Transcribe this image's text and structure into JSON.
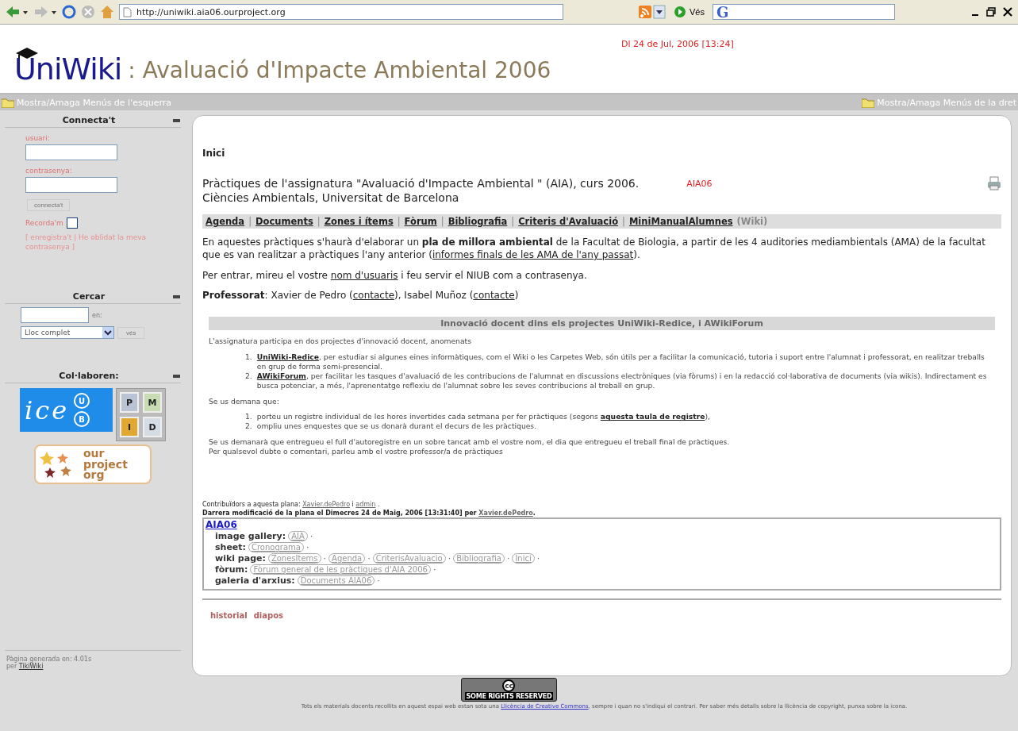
{
  "browser": {
    "url": "http://uniwiki.aia06.ourproject.org",
    "go_label": "Vés",
    "search_logo": "G"
  },
  "header": {
    "logo": "UniWiki",
    "site_title": ": Avaluació d'Impacte Ambiental 2006",
    "date": "Dl 24 de Jul, 2006 [13:24]"
  },
  "toggle_bar": {
    "left": "Mostra/Amaga Menús de l'esquerra",
    "right": "Mostra/Amaga Menús de la dret"
  },
  "sidebar": {
    "login": {
      "title": "Connecta't",
      "user_label": "usuari:",
      "password_label": "contrasenya:",
      "button": "connecta't",
      "remember_label": "Recorda'm",
      "remember_checked": false,
      "links": "[ enregistra't | He oblidat la meva contrasenya ]"
    },
    "search": {
      "title": "Cercar",
      "in_label": "en:",
      "scope": "Lloc complet",
      "button": "vés"
    },
    "partners": {
      "title": "Col·laboren:",
      "ice": {
        "word": "ice",
        "marks": [
          "U",
          "B"
        ]
      },
      "tiles": [
        {
          "letter": "P",
          "color": "#b8c4d4"
        },
        {
          "letter": "M",
          "color": "#c8dcb4"
        },
        {
          "letter": "I",
          "color": "#e0a830"
        },
        {
          "letter": "D",
          "color": "#d4dce4"
        }
      ],
      "ourproject": [
        "our",
        "project",
        "org"
      ]
    },
    "generated": "Pàgina generada en: 4.01s",
    "by": "per",
    "engine": "TikiWiki"
  },
  "main": {
    "page_name": "Inici",
    "title_lines": [
      "Pràctiques de l'assignatura \"Avaluació d'Impacte Ambiental \" (AIA), curs 2006.",
      "Ciències Ambientals, Universitat de Barcelona"
    ],
    "tag": "AIA06",
    "nav": {
      "separator": "|",
      "links": [
        "Agenda",
        "Documents",
        "Zones i ítems",
        "Fòrum",
        "Bibliografia",
        "Criteris d'Avaluació",
        "MiniManualAlumnes"
      ],
      "suffix": "(Wiki)"
    },
    "paragraphs": [
      [
        {
          "kind": "text",
          "text": "En aquestes pràctiques s'haurà d'elaborar un "
        },
        {
          "kind": "bold",
          "text": "pla de millora ambiental"
        },
        {
          "kind": "text",
          "text": " de la Facultat de Biologia, a partir de les 4 auditories mediambientals (AMA) de la facultat que es van realitzar a pràctiques l'any anterior ("
        },
        {
          "kind": "link",
          "text": "informes finals de les AMA de l'any passat"
        },
        {
          "kind": "text",
          "text": ")."
        }
      ],
      [
        {
          "kind": "text",
          "text": "Per entrar, mireu el vostre "
        },
        {
          "kind": "link",
          "text": "nom d'usuaris"
        },
        {
          "kind": "text",
          "text": " i feu servir el NIUB com a contrasenya."
        }
      ],
      [
        {
          "kind": "bold",
          "text": "Professorat"
        },
        {
          "kind": "text",
          "text": ": Xavier de Pedro ("
        },
        {
          "kind": "link",
          "text": "contacte"
        },
        {
          "kind": "text",
          "text": "), Isabel Muñoz ("
        },
        {
          "kind": "link",
          "text": "contacte"
        },
        {
          "kind": "text",
          "text": ")"
        }
      ]
    ],
    "box": {
      "heading": "Innovació docent dins els projectes UniWiki-Redice, i AWikiForum",
      "intro": "L'assignatura participa en dos projectes d'innovació docent, anomenats",
      "list1": [
        {
          "number": "1.",
          "segments": [
            {
              "kind": "bold-link",
              "text": "UniWiki-Redice"
            },
            {
              "kind": "text",
              "text": ", per estudiar si algunes eines informàtiques, com el Wiki o les Carpetes Web, són útils per a facilitar la comunicació, tutoria i suport entre l'alumnat i professorat, en realitzar treballs en grup de forma semi-presencial."
            }
          ]
        },
        {
          "number": "2.",
          "segments": [
            {
              "kind": "bold-link",
              "text": "AWikiForum"
            },
            {
              "kind": "text",
              "text": ", per facilitar les tasques d'avaluació de les contribucions de l'alumnat en discussions electròniques (via fòrums) i en la redacció col·laborativa de documents (via wikis). Indirectament es busca potenciar, a més, l'aprenentatge reflexiu de l'alumnat sobre les seves contribucions al treball en grup."
            }
          ]
        }
      ],
      "ask": "Se us demana que:",
      "list2": [
        {
          "number": "1.",
          "segments": [
            {
              "kind": "text",
              "text": "porteu un registre individual de les hores invertides cada setmana per fer pràctiques (segons "
            },
            {
              "kind": "bold-link",
              "text": "aquesta taula de registre"
            },
            {
              "kind": "text",
              "text": "),"
            }
          ]
        },
        {
          "number": "2.",
          "segments": [
            {
              "kind": "text",
              "text": "ompliu unes enquestes que se us donarà durant el decurs de les pràctiques."
            }
          ]
        }
      ],
      "closing": [
        "Se us demanarà que entregueu el full d'autoregistre en un sobre tancat amb el vostre nom, el dia que entregueu el treball final de pràctiques.",
        "Per qualsevol dubte o comentari, parleu amb el vostre professor/a de pràctiques"
      ]
    },
    "contributors": [
      {
        "kind": "text",
        "text": "Contribuïdors a aquesta plana: "
      },
      {
        "kind": "link",
        "text": "Xavier.dePedro"
      },
      {
        "kind": "text",
        "text": " i "
      },
      {
        "kind": "link",
        "text": "admin"
      },
      {
        "kind": "text",
        "text": " ."
      }
    ],
    "modified": [
      {
        "kind": "text",
        "text": "Darrera modificació de la plana el Dimecres 24 de Maig, 2006 [13:31:40] per "
      },
      {
        "kind": "link",
        "text": "Xavier.dePedro"
      },
      {
        "kind": "text",
        "text": "."
      }
    ],
    "structure": {
      "title": "AIA06",
      "separator": "·",
      "rows": [
        {
          "label": "image gallery:",
          "items": [
            "AIA"
          ]
        },
        {
          "label": "sheet:",
          "items": [
            "Cronograma"
          ]
        },
        {
          "label": "wiki page:",
          "items": [
            "ZonesItems",
            "Agenda",
            "CriterisAvaluacio",
            "Bibliografia",
            "Inici"
          ]
        },
        {
          "label": "fòrum:",
          "items": [
            "Fòrum general de les pràctiques d'AIA 2006"
          ]
        },
        {
          "label": "galeria d'arxius:",
          "items": [
            "Documents AIA06"
          ]
        }
      ]
    },
    "actions": [
      "historial",
      "diapos"
    ]
  },
  "footer": {
    "cc_mark": "cc",
    "cc_text": "SOME RIGHTS RESERVED",
    "license": [
      {
        "kind": "text",
        "text": "Tots els materials docents recollits en aquest espai web estan sota una "
      },
      {
        "kind": "link",
        "text": "Llicència de Creative Commons"
      },
      {
        "kind": "text",
        "text": ", sempre i quan no s'indiqui el contrari. Per saber més detalls sobre la llicència de copyright, punxa sobre la icona."
      }
    ]
  }
}
